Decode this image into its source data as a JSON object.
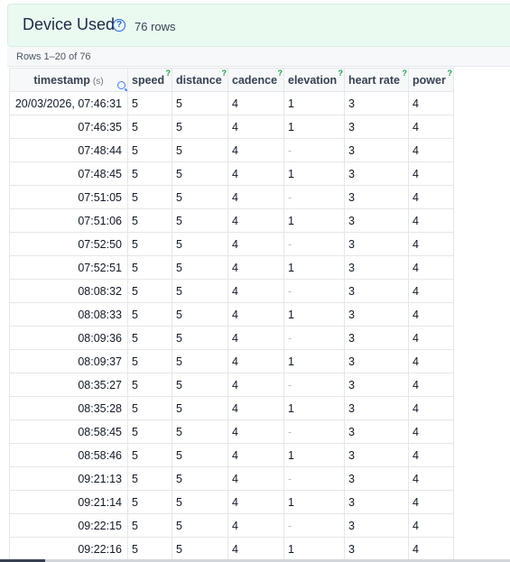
{
  "header": {
    "title": "Device Used",
    "help_icon": "?",
    "row_count": "76 rows"
  },
  "subbar": {
    "range": "Rows 1–20 of 76"
  },
  "table": {
    "columns": [
      {
        "label": "timestamp",
        "unit": "(s)"
      },
      {
        "label": "speed",
        "hint": "?"
      },
      {
        "label": "distance",
        "hint": "?"
      },
      {
        "label": "cadence",
        "hint": "?"
      },
      {
        "label": "elevation",
        "hint": "?"
      },
      {
        "label": "heart rate",
        "hint": "?"
      },
      {
        "label": "power",
        "hint": "?"
      }
    ],
    "rows": [
      [
        "20/03/2026, 07:46:31",
        "5",
        "5",
        "4",
        "1",
        "3",
        "4"
      ],
      [
        "07:46:35",
        "5",
        "5",
        "4",
        "1",
        "3",
        "4"
      ],
      [
        "07:48:44",
        "5",
        "5",
        "4",
        "-",
        "3",
        "4"
      ],
      [
        "07:48:45",
        "5",
        "5",
        "4",
        "1",
        "3",
        "4"
      ],
      [
        "07:51:05",
        "5",
        "5",
        "4",
        "-",
        "3",
        "4"
      ],
      [
        "07:51:06",
        "5",
        "5",
        "4",
        "1",
        "3",
        "4"
      ],
      [
        "07:52:50",
        "5",
        "5",
        "4",
        "-",
        "3",
        "4"
      ],
      [
        "07:52:51",
        "5",
        "5",
        "4",
        "1",
        "3",
        "4"
      ],
      [
        "08:08:32",
        "5",
        "5",
        "4",
        "-",
        "3",
        "4"
      ],
      [
        "08:08:33",
        "5",
        "5",
        "4",
        "1",
        "3",
        "4"
      ],
      [
        "08:09:36",
        "5",
        "5",
        "4",
        "-",
        "3",
        "4"
      ],
      [
        "08:09:37",
        "5",
        "5",
        "4",
        "1",
        "3",
        "4"
      ],
      [
        "08:35:27",
        "5",
        "5",
        "4",
        "-",
        "3",
        "4"
      ],
      [
        "08:35:28",
        "5",
        "5",
        "4",
        "1",
        "3",
        "4"
      ],
      [
        "08:58:45",
        "5",
        "5",
        "4",
        "-",
        "3",
        "4"
      ],
      [
        "08:58:46",
        "5",
        "5",
        "4",
        "1",
        "3",
        "4"
      ],
      [
        "09:21:13",
        "5",
        "5",
        "4",
        "-",
        "3",
        "4"
      ],
      [
        "09:21:14",
        "5",
        "5",
        "4",
        "1",
        "3",
        "4"
      ],
      [
        "09:22:15",
        "5",
        "5",
        "4",
        "-",
        "3",
        "4"
      ],
      [
        "09:22:16",
        "5",
        "5",
        "4",
        "1",
        "3",
        "4"
      ]
    ]
  }
}
